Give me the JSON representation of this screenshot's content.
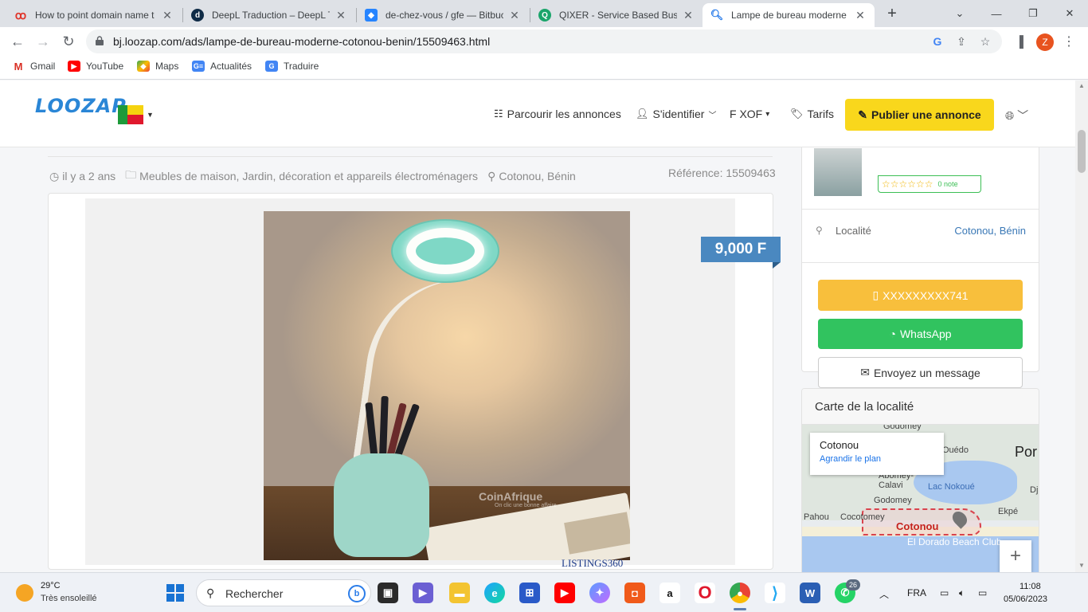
{
  "browser": {
    "tabs": [
      {
        "title": "How to point domain name t",
        "favicon": "red-swirl-icon",
        "color": "#e0352b"
      },
      {
        "title": "DeepL Traduction – DeepL Tr",
        "favicon": "deepl-icon",
        "color": "#0f2b46"
      },
      {
        "title": "de-chez-vous / gfe — Bitbuc",
        "favicon": "bitbucket-icon",
        "color": "#2684ff"
      },
      {
        "title": "QIXER - Service Based Busine",
        "favicon": "qixer-icon",
        "color": "#1ba56b"
      },
      {
        "title": "Lampe de bureau moderne -",
        "favicon": "search-icon",
        "color": "#1a73e8",
        "active": true
      }
    ],
    "new_tab": "+",
    "window_controls": {
      "minimize": "—",
      "restore": "❐",
      "close": "✕",
      "tablist": "⌄"
    },
    "url": "bj.loozap.com/ads/lampe-de-bureau-moderne-cotonou-benin/15509463.html",
    "profile_initial": "Z",
    "bookmarks": [
      {
        "label": "Gmail",
        "icon": "gmail-icon"
      },
      {
        "label": "YouTube",
        "icon": "youtube-icon"
      },
      {
        "label": "Maps",
        "icon": "maps-icon"
      },
      {
        "label": "Actualités",
        "icon": "news-icon"
      },
      {
        "label": "Traduire",
        "icon": "translate-icon"
      }
    ]
  },
  "site": {
    "logo": "LOOZAP",
    "nav": {
      "browse": "Parcourir les annonces",
      "login": "S'identifier",
      "currency": "F XOF",
      "pricing": "Tarifs",
      "publish": "Publier une annonce"
    },
    "brand_colors": {
      "primary": "#2a86d6",
      "publish": "#f9d71c",
      "price": "#4a88c0"
    }
  },
  "ad": {
    "posted": "il y a 2 ans",
    "category": "Meubles de maison, Jardin, décoration et appareils électroménagers",
    "location": "Cotonou, Bénin",
    "reference": "Référence: 15509463",
    "price": "9,000 F",
    "watermark": "CoinAfrique",
    "watermark_sub": "On clic une bonne affaire",
    "listings_logo": "LISTINGS360"
  },
  "sidebar": {
    "rating_stars": "☆☆☆☆☆☆",
    "rating_count": "0 note",
    "location_label": "Localité",
    "location_value": "Cotonou, Bénin",
    "phone_button": "XXXXXXXXX741",
    "whatsapp_button": "WhatsApp",
    "message_button": "Envoyez un message",
    "map_title": "Carte de la localité",
    "map_popup_title": "Cotonou",
    "map_popup_link": "Agrandir le plan",
    "map_labels": [
      "Godomey",
      "Ouédo",
      "Por",
      "Abomey-Calavi",
      "Lac Nokoué",
      "Dj",
      "Godomey",
      "Ekpé",
      "Pahou",
      "Cocotomey",
      "Cotonou",
      "El Dorado Beach Club"
    ],
    "map_zoom": "+"
  },
  "taskbar": {
    "weather_temp": "29°C",
    "weather_desc": "Très ensoleillé",
    "search_placeholder": "Rechercher",
    "whatsapp_badge": "26",
    "language": "FRA",
    "time": "11:08",
    "date": "05/06/2023"
  }
}
